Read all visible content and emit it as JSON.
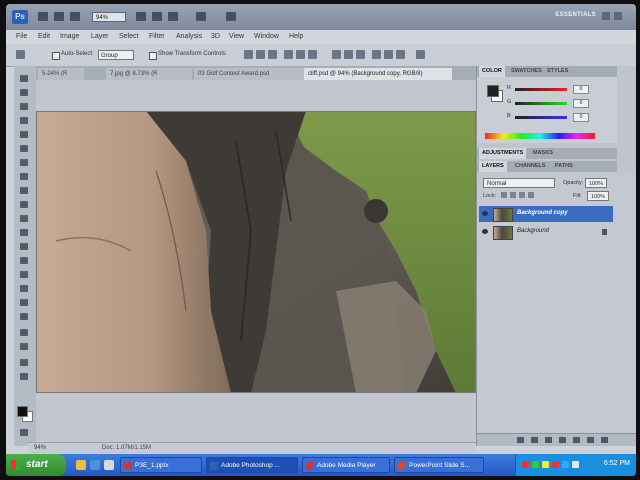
{
  "app": {
    "logo": "Ps",
    "zoom_select": "94%",
    "workspace": "ESSENTIALS"
  },
  "menu": [
    "File",
    "Edit",
    "Image",
    "Layer",
    "Select",
    "Filter",
    "Analysis",
    "3D",
    "View",
    "Window",
    "Help"
  ],
  "options_bar": {
    "auto_select_label": "Auto-Select:",
    "auto_select_value": "Group",
    "show_transform_label": "Show Transform Controls"
  },
  "doc_tabs": [
    {
      "label": "5-24% (R",
      "active": false
    },
    {
      "label": "7.jpg @ 8.73% (R",
      "active": false
    },
    {
      "label": "03 Golf Contest Award.psd",
      "active": false
    },
    {
      "label": "cliff.psd @ 94% (Background copy, RGB/8)",
      "active": true
    }
  ],
  "status": {
    "zoom": "94%",
    "doc_size": "Doc: 1.07M/1.15M"
  },
  "panels": {
    "color_tabs": [
      "COLOR",
      "SWATCHES",
      "STYLES"
    ],
    "color_values": {
      "r": "0",
      "g": "0",
      "b": "0"
    },
    "adjust_tabs": [
      "ADJUSTMENTS",
      "MASKS"
    ],
    "layers_tabs": [
      "LAYERS",
      "CHANNELS",
      "PATHS"
    ],
    "blend_mode": "Normal",
    "opacity_label": "Opacity:",
    "opacity_value": "100%",
    "lock_label": "Lock:",
    "fill_label": "Fill:",
    "fill_value": "100%",
    "layers": [
      {
        "name": "Background copy",
        "selected": true
      },
      {
        "name": "Background",
        "selected": false
      }
    ]
  },
  "taskbar": {
    "start_label": "start",
    "buttons": [
      {
        "label": "P3E_1.pptx",
        "active": false,
        "color": "#c43b3b"
      },
      {
        "label": "Adobe Photoshop ...",
        "active": true,
        "color": "#2a62b5"
      },
      {
        "label": "Adobe Media Player",
        "active": false,
        "color": "#c43b3b"
      },
      {
        "label": "PowerPoint Slide S...",
        "active": false,
        "color": "#d14a2a"
      }
    ],
    "clock": "6:52 PM"
  },
  "colors": {
    "accent": "#3b6cc4",
    "taskbar": "#2359c6",
    "start": "#3a9a3a"
  }
}
